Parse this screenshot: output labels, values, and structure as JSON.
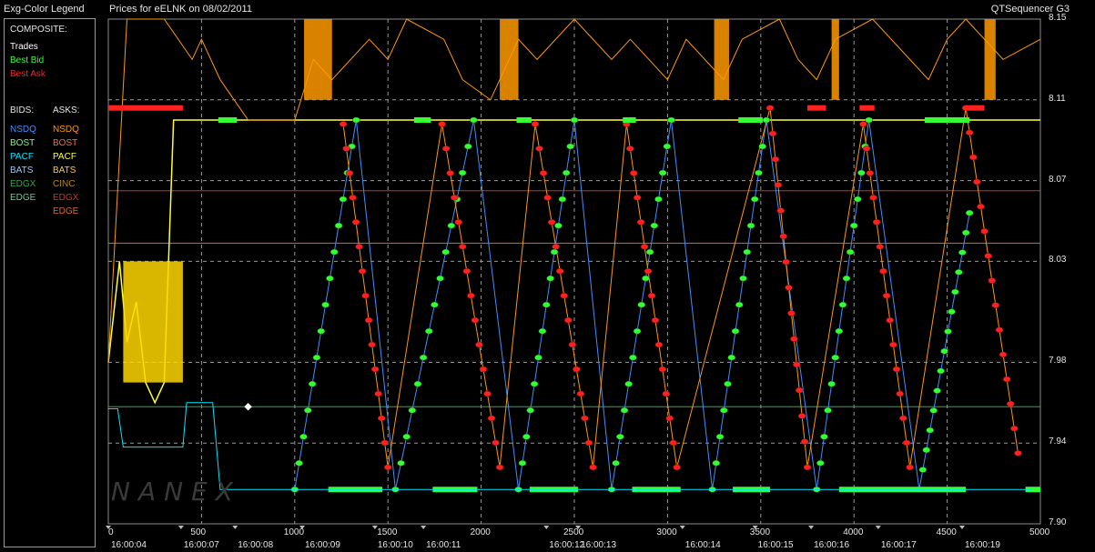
{
  "legend": {
    "title": "Exg-Color Legend",
    "composite_label": "COMPOSITE:",
    "composite_items": [
      {
        "label": "Trades",
        "color": "#ffffff"
      },
      {
        "label": "Best Bid",
        "color": "#33ff33"
      },
      {
        "label": "Best Ask",
        "color": "#ff2020"
      }
    ],
    "bids_label": "BIDS:",
    "asks_label": "ASKS:",
    "bids": [
      {
        "label": "NSDQ",
        "color": "#3f8fff"
      },
      {
        "label": "BOST",
        "color": "#90ee90"
      },
      {
        "label": "PACF",
        "color": "#00e5ff"
      },
      {
        "label": "BATS",
        "color": "#9bc8ff"
      },
      {
        "label": "EDGX",
        "color": "#2fa84f"
      },
      {
        "label": "EDGE",
        "color": "#66cc99"
      }
    ],
    "asks": [
      {
        "label": "NSDQ",
        "color": "#ff9900"
      },
      {
        "label": "BOST",
        "color": "#ff6a3d"
      },
      {
        "label": "PACF",
        "color": "#ffff33"
      },
      {
        "label": "BATS",
        "color": "#ffcc33"
      },
      {
        "label": "CINC",
        "color": "#b8860b"
      },
      {
        "label": "EDGX",
        "color": "#c0392b"
      },
      {
        "label": "EDGE",
        "color": "#d2693c"
      }
    ]
  },
  "header": {
    "chart_title": "Prices for  eELNK  on  08/02/2011",
    "app_name": "QTSequencer G3"
  },
  "watermark": "NANEX",
  "chart_data": {
    "type": "line",
    "ylim": [
      7.9,
      8.15
    ],
    "xlim": [
      0,
      5000
    ],
    "y_ticks": [
      {
        "value": 8.15,
        "label": "8.15"
      },
      {
        "value": 8.11,
        "label": "8.11"
      },
      {
        "value": 8.07,
        "label": "8.07"
      },
      {
        "value": 8.03,
        "label": "8.03"
      },
      {
        "value": 7.98,
        "label": "7.98"
      },
      {
        "value": 7.94,
        "label": "7.94"
      },
      {
        "value": 7.9,
        "label": "7.90"
      }
    ],
    "x_ticks": [
      {
        "value": 0,
        "label": "0"
      },
      {
        "value": 500,
        "label": "500"
      },
      {
        "value": 1000,
        "label": "1000"
      },
      {
        "value": 1500,
        "label": "1500"
      },
      {
        "value": 2000,
        "label": "2000"
      },
      {
        "value": 2500,
        "label": "2500"
      },
      {
        "value": 3000,
        "label": "3000"
      },
      {
        "value": 3500,
        "label": "3500"
      },
      {
        "value": 4000,
        "label": "4000"
      },
      {
        "value": 4500,
        "label": "4500"
      },
      {
        "value": 5000,
        "label": "5000"
      }
    ],
    "time_labels": [
      {
        "value": 0,
        "label": "16:00:04"
      },
      {
        "value": 390,
        "label": "16:00:07"
      },
      {
        "value": 680,
        "label": "16:00:08"
      },
      {
        "value": 1040,
        "label": "16:00:09"
      },
      {
        "value": 1430,
        "label": "16:00:10"
      },
      {
        "value": 1690,
        "label": "16:00:11"
      },
      {
        "value": 2350,
        "label": "16:00:12"
      },
      {
        "value": 2520,
        "label": "16:00:13"
      },
      {
        "value": 3080,
        "label": "16:00:14"
      },
      {
        "value": 3470,
        "label": "16:00:15"
      },
      {
        "value": 3770,
        "label": "16:00:16"
      },
      {
        "value": 4130,
        "label": "16:00:17"
      },
      {
        "value": 4580,
        "label": "16:00:19"
      }
    ],
    "reference_lines": [
      {
        "value": 8.065,
        "color": "#c0392b"
      },
      {
        "value": 8.039,
        "color": "#d2693c"
      },
      {
        "value": 7.958,
        "color": "#2fa84f"
      }
    ],
    "best_bid_cycles": [
      {
        "start": 1000,
        "end": 1330,
        "low": 7.917,
        "high": 8.1
      },
      {
        "start": 1540,
        "end": 1960,
        "low": 7.917,
        "high": 8.1
      },
      {
        "start": 2200,
        "end": 2500,
        "low": 7.917,
        "high": 8.1
      },
      {
        "start": 2700,
        "end": 3020,
        "low": 7.917,
        "high": 8.1
      },
      {
        "start": 3240,
        "end": 3530,
        "low": 7.917,
        "high": 8.1
      },
      {
        "start": 3800,
        "end": 4080,
        "low": 7.917,
        "high": 8.1
      },
      {
        "start": 4350,
        "end": 4620,
        "low": 7.917,
        "high": 8.054
      }
    ],
    "best_ask_cycles": [
      {
        "start": 1260,
        "end": 1500,
        "high": 8.098,
        "low": 7.928
      },
      {
        "start": 1790,
        "end": 2100,
        "high": 8.098,
        "low": 7.928
      },
      {
        "start": 2290,
        "end": 2600,
        "high": 8.098,
        "low": 7.928
      },
      {
        "start": 2780,
        "end": 3050,
        "high": 8.098,
        "low": 7.928
      },
      {
        "start": 3550,
        "end": 3750,
        "high": 8.106,
        "low": 7.928
      },
      {
        "start": 4050,
        "end": 4300,
        "high": 8.098,
        "low": 7.928
      },
      {
        "start": 4600,
        "end": 4880,
        "high": 8.106,
        "low": 7.935
      }
    ]
  }
}
